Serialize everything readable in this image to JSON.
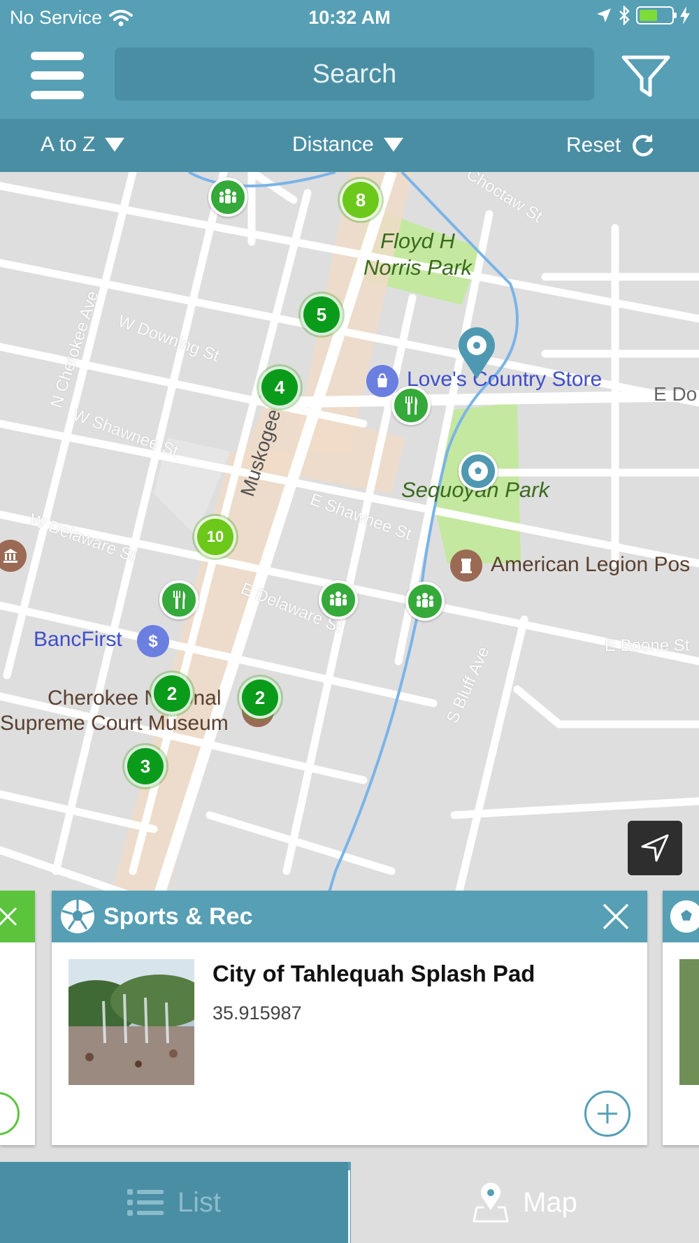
{
  "status_bar": {
    "carrier": "No Service",
    "time": "10:32 AM",
    "battery_level": 0.55
  },
  "header": {
    "search_placeholder": "Search",
    "menu_icon": "hamburger-icon",
    "filter_icon": "funnel-icon"
  },
  "sort_bar": {
    "az_label": "A to Z",
    "distance_label": "Distance",
    "reset_label": "Reset"
  },
  "map": {
    "parks": [
      "Floyd H\nNorris Park",
      "Sequoyah Park"
    ],
    "places": {
      "store": "Love's Country Store",
      "legion": "American Legion Pos",
      "bank": "BancFirst",
      "museum_line1": "Cherokee National",
      "museum_line2": "Supreme Court Museum"
    },
    "streets": {
      "muskogee": "Muskogee Ave",
      "w_downing": "W Downing St",
      "w_shawnee": "W Shawnee St",
      "e_shawnee": "E Shawnee St",
      "w_delaware": "W Delaware St",
      "e_delaware": "E Delaware St",
      "e_boone": "E Boone St",
      "n_cherokee": "N Cherokee Ave",
      "s_bluff": "S Bluff Ave",
      "e_do": "E Do",
      "choctaw": "Choctaw St"
    },
    "clusters": [
      "8",
      "5",
      "4",
      "10",
      "2",
      "2",
      "3"
    ],
    "colors": {
      "cluster_light": "#6cc81a",
      "cluster_dark": "#0b9b1b",
      "pin_green": "#35a93a",
      "pin_blue": "#4f98b2"
    }
  },
  "card": {
    "category": "Sports & Rec",
    "title": "City of Tahlequah Splash Pad",
    "subtitle": "35.915987"
  },
  "bottom_nav": {
    "list_label": "List",
    "map_label": "Map"
  }
}
